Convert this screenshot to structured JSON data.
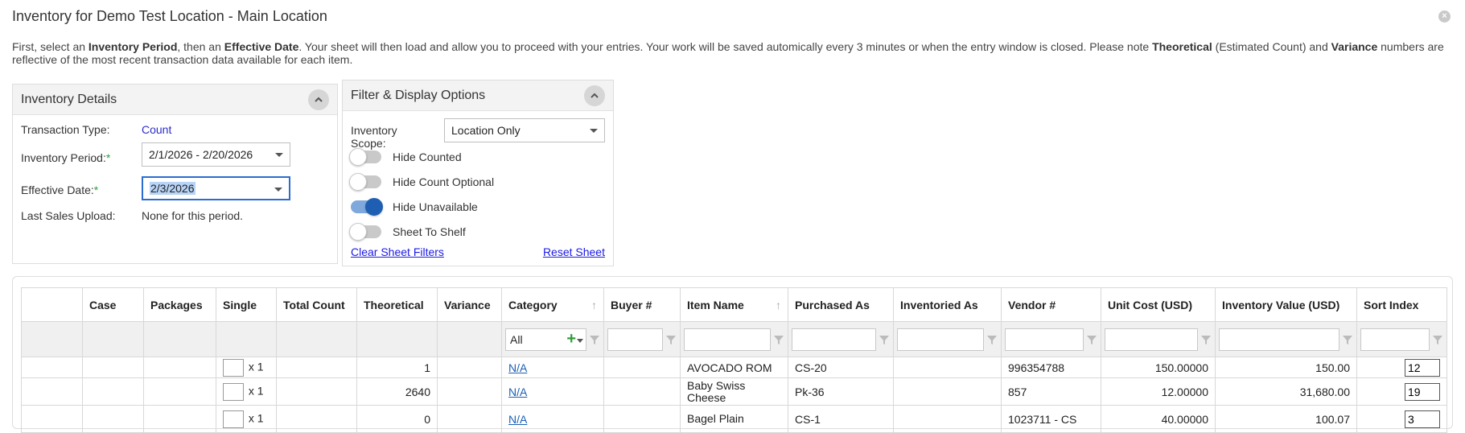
{
  "window": {
    "title": "Inventory for Demo Test Location - Main Location",
    "close_icon": "close-circle-icon"
  },
  "intro": {
    "p1": "First, select an ",
    "b1": "Inventory Period",
    "p2": ", then an ",
    "b2": "Effective Date",
    "p3": ". Your sheet will then load and allow you to proceed with your entries. Your work will be saved automically every 3 minutes or when the entry window is closed. Please note ",
    "b3": "Theoretical",
    "p4": " (Estimated Count) and ",
    "b4": "Variance",
    "p5": " numbers are reflective of the most recent transaction data available for each item."
  },
  "details": {
    "title": "Inventory Details",
    "transaction_type_label": "Transaction Type:",
    "transaction_type_value": "Count",
    "period_label": "Inventory Period:",
    "period_value": "2/1/2026 - 2/20/2026",
    "effective_label": "Effective Date:",
    "effective_value": "2/3/2026",
    "required_mark": "*",
    "last_sales_label": "Last Sales Upload:",
    "last_sales_value": "None for this period."
  },
  "filter": {
    "title": "Filter & Display Options",
    "scope_label": "Inventory Scope:",
    "scope_value": "Location Only",
    "toggles": [
      {
        "label": "Hide Counted",
        "on": false
      },
      {
        "label": "Hide Count Optional",
        "on": false
      },
      {
        "label": "Hide Unavailable",
        "on": true
      },
      {
        "label": "Sheet To Shelf",
        "on": false
      }
    ],
    "clear_link": "Clear Sheet Filters",
    "reset_link": "Reset Sheet"
  },
  "grid": {
    "columns": [
      "",
      "Case",
      "Packages",
      "Single",
      "Total Count",
      "Theoretical",
      "Variance",
      "Category",
      "Buyer #",
      "Item Name",
      "Purchased As",
      "Inventoried As",
      "Vendor #",
      "Unit Cost (USD)",
      "Inventory Value (USD)",
      "Sort Index"
    ],
    "category_filter_value": "All",
    "single_suffix": "x 1",
    "rows": [
      {
        "theoretical": "1",
        "category": "N/A",
        "item": "AVOCADO ROM",
        "purchased": "CS-20",
        "vendor": "996354788",
        "unit_cost": "150.00000",
        "value": "150.00",
        "sort": "12"
      },
      {
        "theoretical": "2640",
        "category": "N/A",
        "item": "Baby Swiss Cheese",
        "purchased": "Pk-36",
        "vendor": "857",
        "unit_cost": "12.00000",
        "value": "31,680.00",
        "sort": "19"
      },
      {
        "theoretical": "0",
        "category": "N/A",
        "item": "Bagel Plain",
        "purchased": "CS-1",
        "vendor": "1023711 - CS",
        "unit_cost": "40.00000",
        "value": "100.07",
        "sort": "3"
      }
    ]
  }
}
